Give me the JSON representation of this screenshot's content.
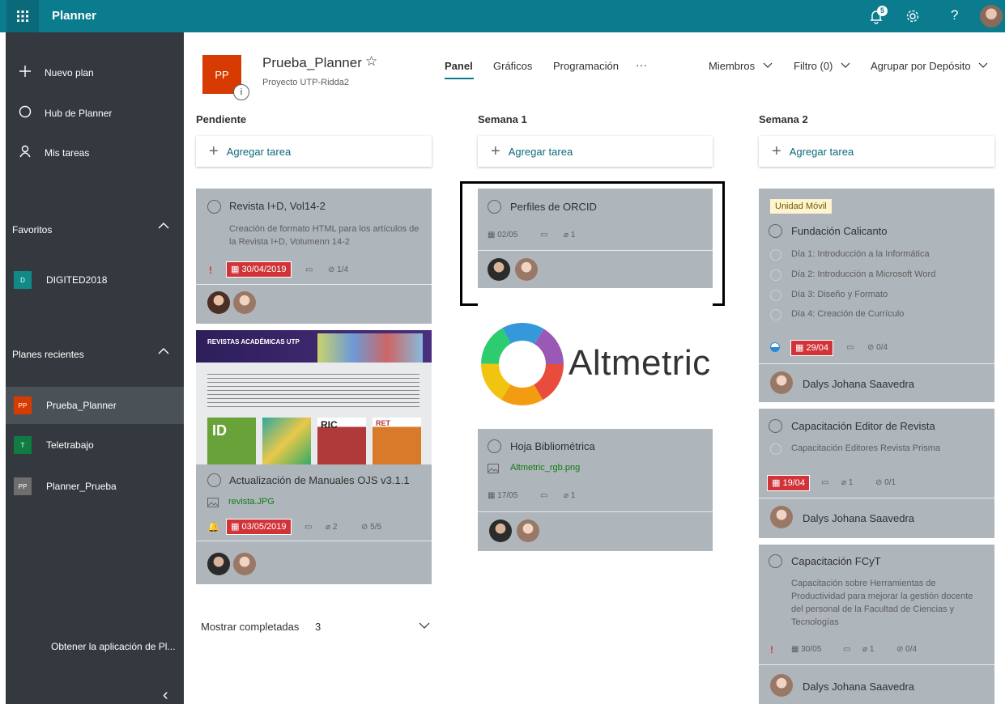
{
  "app": {
    "title": "Planner",
    "notification_count": "5",
    "help": "?"
  },
  "sidebar": {
    "new_plan": "Nuevo plan",
    "hub": "Hub de Planner",
    "my_tasks": "Mis tareas",
    "favorites_header": "Favoritos",
    "favorites": [
      {
        "initial": "D",
        "name": "DIGITED2018",
        "color": "#0f8a86"
      }
    ],
    "recent_header": "Planes recientes",
    "recent": [
      {
        "initial": "PP",
        "name": "Prueba_Planner",
        "color": "#d83b01"
      },
      {
        "initial": "T",
        "name": "Teletrabajo",
        "color": "#107c41"
      },
      {
        "initial": "PP",
        "name": "Planner_Prueba",
        "color": "#6e6e6e"
      }
    ],
    "get_app": "Obtener la aplicación de Pl...",
    "collapse": "‹"
  },
  "plan": {
    "initials": "PP",
    "name": "Prueba_Planner",
    "star": "☆",
    "group": "Proyecto UTP-Ridda2",
    "info": "i"
  },
  "tabs": {
    "panel": "Panel",
    "charts": "Gráficos",
    "schedule": "Programación",
    "more": "···"
  },
  "toolbar": {
    "members": "Miembros",
    "filter": "Filtro (0)",
    "group_by": "Agrupar por Depósito"
  },
  "buckets": {
    "b1": "Pendiente",
    "b2": "Semana 1",
    "b3": "Semana 2",
    "add_task": "Agregar tarea"
  },
  "cards": {
    "c1": {
      "title": "Revista I+D, Vol14-2",
      "desc": "Creación de formato HTML para los artículos de la Revista I+D, Volumenn 14-2",
      "priority": "!",
      "date": "30/04/2019",
      "checklist": "1/4"
    },
    "c2": {
      "image_title": "REVISTAS ACADÉMICAS UTP",
      "thumb_labels": [
        "ID",
        "RIC",
        "RET"
      ],
      "title": "Actualización de Manuales OJS v3.1.1",
      "attachment": "revista.JPG",
      "date": "03/05/2019",
      "attachments": "2",
      "checklist": "5/5"
    },
    "c3": {
      "title": "Perfiles de ORCID",
      "date": "02/05",
      "attachments": "1"
    },
    "c4": {
      "image_text": "Altmetric",
      "title": "Hoja Bibliométrica",
      "attachment": "Altmetric_rgb.png",
      "date": "17/05",
      "attachments": "1"
    },
    "c5": {
      "label": "Unidad Móvil",
      "title": "Fundación Calicanto",
      "checklist_items": [
        "Día 1: Introducción a la Informática",
        "Día 2: Introducción a Microsoft Word",
        "Día 3: Diseño y Formato",
        "Día 4: Creación de Currículo"
      ],
      "date": "29/04",
      "checklist": "0/4",
      "assignee": "Dalys Johana Saavedra"
    },
    "c6": {
      "title": "Capacitación Editor de Revista",
      "checklist_item": "Capacitación Editores Revista Prisma",
      "date": "19/04",
      "attachments": "1",
      "checklist": "0/1",
      "assignee": "Dalys Johana Saavedra"
    },
    "c7": {
      "title": "Capacitación FCyT",
      "desc": "Capacitación sobre Herramientas de Productividad para mejorar la gestión docente del personal de la Facultad de Ciencias y Tecnologías",
      "priority": "!",
      "date": "30/05",
      "attachments": "1",
      "checklist": "0/4",
      "assignee": "Dalys Johana Saavedra"
    }
  },
  "completed": {
    "label": "Mostrar completadas",
    "count": "3"
  },
  "colors": {
    "header": "#0b7b8e",
    "sidebar": "#33393e",
    "card": "#aeb5bb",
    "overdue": "#d13438",
    "accent": "#0b6a7a"
  }
}
